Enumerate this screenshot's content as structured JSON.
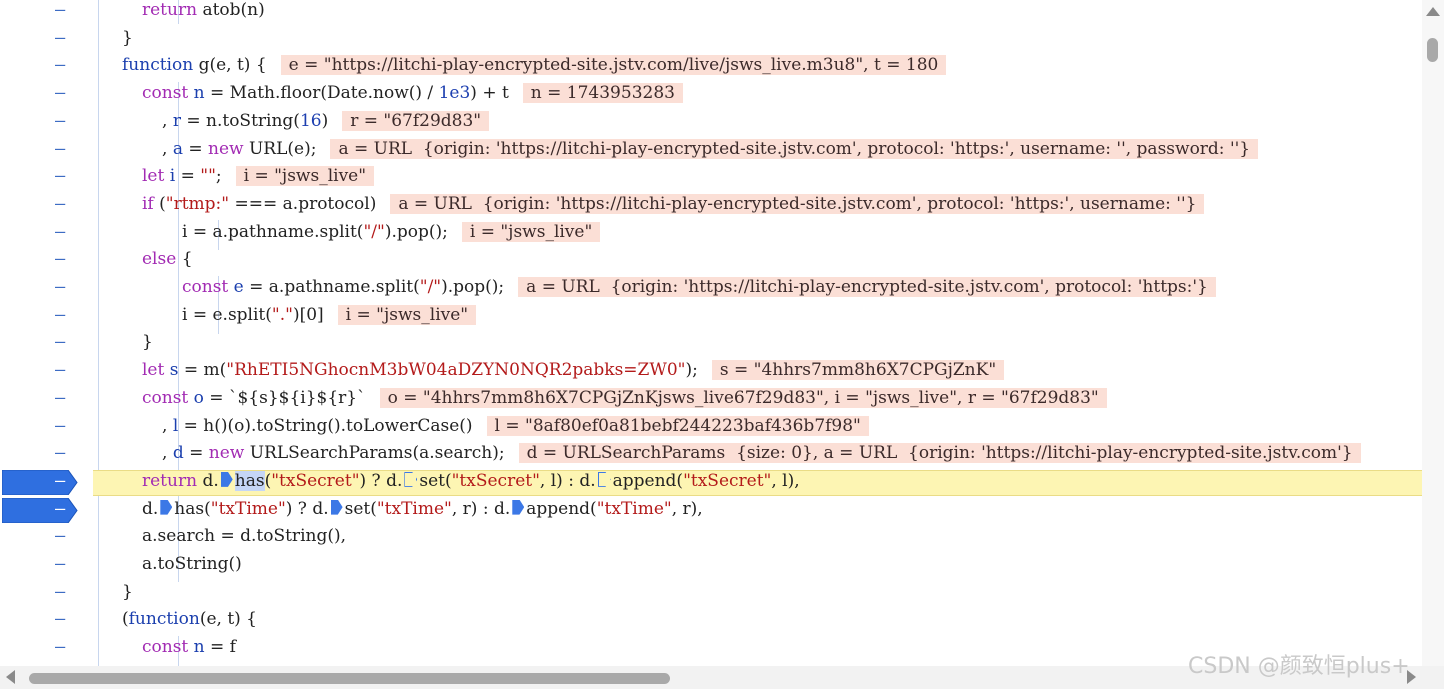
{
  "gutter_marker": "–",
  "lines": [
    {
      "indent": "    ",
      "parts": [
        [
          "kw",
          "return"
        ],
        [
          "plain",
          " atob(n)"
        ]
      ]
    },
    {
      "indent": "  ",
      "parts": [
        [
          "plain",
          "}"
        ]
      ]
    },
    {
      "indent": "  ",
      "parts": [
        [
          "kw2",
          "function"
        ],
        [
          "plain",
          " g(e, t) {"
        ]
      ],
      "inline": "e = \"https://litchi-play-encrypted-site.jstv.com/live/jsws_live.m3u8\", t = 180"
    },
    {
      "indent": "    ",
      "parts": [
        [
          "kw",
          "const"
        ],
        [
          "vn",
          " n"
        ],
        [
          "plain",
          " = Math.floor(Date.now() / "
        ],
        [
          "num",
          "1e3"
        ],
        [
          "plain",
          ") + t"
        ]
      ],
      "inline": "n = 1743953283"
    },
    {
      "indent": "      ",
      "parts": [
        [
          "plain",
          ", "
        ],
        [
          "vn",
          "r"
        ],
        [
          "plain",
          " = n.toString("
        ],
        [
          "num",
          "16"
        ],
        [
          "plain",
          ")"
        ]
      ],
      "inline": "r = \"67f29d83\""
    },
    {
      "indent": "      ",
      "parts": [
        [
          "plain",
          ", "
        ],
        [
          "vn",
          "a"
        ],
        [
          "plain",
          " = "
        ],
        [
          "kw",
          "new"
        ],
        [
          "plain",
          " URL(e);"
        ]
      ],
      "inline": "a = URL  {origin: 'https://litchi-play-encrypted-site.jstv.com', protocol: 'https:', username: '', password: ''}"
    },
    {
      "indent": "    ",
      "parts": [
        [
          "kw",
          "let"
        ],
        [
          "vn",
          " i"
        ],
        [
          "plain",
          " = "
        ],
        [
          "str",
          "\"\""
        ],
        [
          "plain",
          ";"
        ]
      ],
      "inline": "i = \"jsws_live\""
    },
    {
      "indent": "    ",
      "parts": [
        [
          "kw",
          "if"
        ],
        [
          "plain",
          " ("
        ],
        [
          "str",
          "\"rtmp:\""
        ],
        [
          "plain",
          " === a.protocol)"
        ]
      ],
      "inline": "a = URL  {origin: 'https://litchi-play-encrypted-site.jstv.com', protocol: 'https:', username: ''}"
    },
    {
      "indent": "        ",
      "parts": [
        [
          "plain",
          "i = a.pathname.split("
        ],
        [
          "str",
          "\"/\""
        ],
        [
          "plain",
          ").pop();"
        ]
      ],
      "inline": "i = \"jsws_live\""
    },
    {
      "indent": "    ",
      "parts": [
        [
          "kw",
          "else"
        ],
        [
          "plain",
          " {"
        ]
      ]
    },
    {
      "indent": "        ",
      "parts": [
        [
          "kw",
          "const"
        ],
        [
          "vn",
          " e"
        ],
        [
          "plain",
          " = a.pathname.split("
        ],
        [
          "str",
          "\"/\""
        ],
        [
          "plain",
          ").pop();"
        ]
      ],
      "inline": "a = URL  {origin: 'https://litchi-play-encrypted-site.jstv.com', protocol: 'https:'}"
    },
    {
      "indent": "        ",
      "parts": [
        [
          "plain",
          "i = e.split("
        ],
        [
          "str",
          "\".\""
        ],
        [
          "plain",
          ")[0]"
        ]
      ],
      "inline": "i = \"jsws_live\""
    },
    {
      "indent": "    ",
      "parts": [
        [
          "plain",
          "}"
        ]
      ]
    },
    {
      "indent": "    ",
      "parts": [
        [
          "kw",
          "let"
        ],
        [
          "vn",
          " s"
        ],
        [
          "plain",
          " = m("
        ],
        [
          "str",
          "\"RhETI5NGhocnM3bW04aDZYN0NQR2pabks=ZW0\""
        ],
        [
          "plain",
          ");"
        ]
      ],
      "inline": "s = \"4hhrs7mm8h6X7CPGjZnK\""
    },
    {
      "indent": "    ",
      "parts": [
        [
          "kw",
          "const"
        ],
        [
          "vn",
          " o"
        ],
        [
          "plain",
          " = `${s}${i}${r}`"
        ]
      ],
      "inline": "o = \"4hhrs7mm8h6X7CPGjZnKjsws_live67f29d83\", i = \"jsws_live\", r = \"67f29d83\""
    },
    {
      "indent": "      ",
      "parts": [
        [
          "plain",
          ", "
        ],
        [
          "vn",
          "l"
        ],
        [
          "plain",
          " = h()(o).toString().toLowerCase()"
        ]
      ],
      "inline": "l = \"8af80ef0a81bebf244223baf436b7f98\""
    },
    {
      "indent": "      ",
      "parts": [
        [
          "plain",
          ", "
        ],
        [
          "vn",
          "d"
        ],
        [
          "plain",
          " = "
        ],
        [
          "kw",
          "new"
        ],
        [
          "plain",
          " URLSearchParams(a.search);"
        ]
      ],
      "inline": "d = URLSearchParams  {size: 0}, a = URL  {origin: 'https://litchi-play-encrypted-site.jstv.com'}"
    },
    {
      "indent": "    ",
      "current": true,
      "breakpoint": true,
      "parts": [
        [
          "kw",
          "return"
        ],
        [
          "plain",
          " d."
        ],
        [
          "mk",
          ""
        ],
        [
          "sel",
          "has"
        ],
        [
          "plain",
          "("
        ],
        [
          "str",
          "\"txSecret\""
        ],
        [
          "plain",
          ") ? d."
        ],
        [
          "mko",
          ""
        ],
        [
          "plain",
          "set("
        ],
        [
          "str",
          "\"txSecret\""
        ],
        [
          "plain",
          ", l) : d."
        ],
        [
          "mko",
          ""
        ],
        [
          "plain",
          "append("
        ],
        [
          "str",
          "\"txSecret\""
        ],
        [
          "plain",
          ", l),"
        ]
      ]
    },
    {
      "indent": "    ",
      "breakpoint": true,
      "parts": [
        [
          "plain",
          "d."
        ],
        [
          "mk",
          ""
        ],
        [
          "plain",
          "has("
        ],
        [
          "str",
          "\"txTime\""
        ],
        [
          "plain",
          ") ? d."
        ],
        [
          "mk",
          ""
        ],
        [
          "plain",
          "set("
        ],
        [
          "str",
          "\"txTime\""
        ],
        [
          "plain",
          ", r) : d."
        ],
        [
          "mk",
          ""
        ],
        [
          "plain",
          "append("
        ],
        [
          "str",
          "\"txTime\""
        ],
        [
          "plain",
          ", r),"
        ]
      ]
    },
    {
      "indent": "    ",
      "parts": [
        [
          "plain",
          "a.search = d.toString(),"
        ]
      ]
    },
    {
      "indent": "    ",
      "parts": [
        [
          "plain",
          "a.toString()"
        ]
      ]
    },
    {
      "indent": "  ",
      "parts": [
        [
          "plain",
          "}"
        ]
      ]
    },
    {
      "indent": "  ",
      "parts": [
        [
          "plain",
          "("
        ],
        [
          "kw2",
          "function"
        ],
        [
          "plain",
          "(e, t) {"
        ]
      ]
    },
    {
      "indent": "    ",
      "parts": [
        [
          "kw",
          "const"
        ],
        [
          "vn",
          " n"
        ],
        [
          "plain",
          " = f"
        ]
      ]
    }
  ],
  "watermark": "CSDN @颜致恒plus+"
}
